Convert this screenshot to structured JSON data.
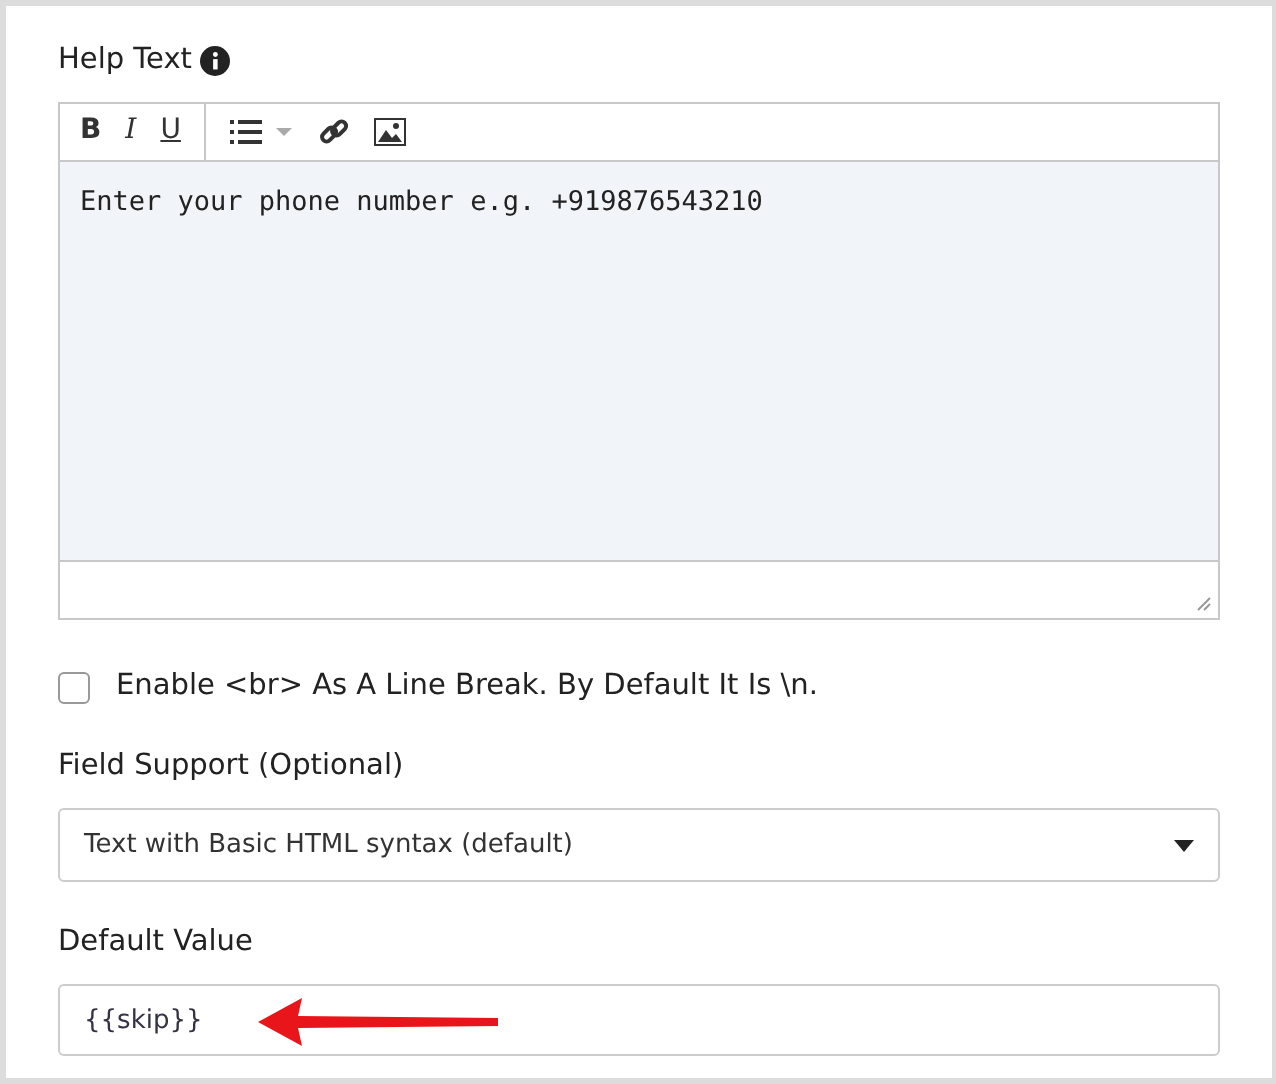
{
  "help_text": {
    "label": "Help Text",
    "toolbar": [
      {
        "kind": "bold",
        "label": "B"
      },
      {
        "kind": "italic",
        "label": "I"
      },
      {
        "kind": "underline",
        "label": "U"
      },
      {
        "kind": "list"
      },
      {
        "kind": "link"
      },
      {
        "kind": "image"
      }
    ],
    "content": "Enter your phone number e.g. +919876543210"
  },
  "line_break_option": {
    "label": "Enable <br> As A Line Break. By Default It Is \\n.",
    "checked": false
  },
  "field_support": {
    "label": "Field Support (Optional)",
    "value": "Text with Basic HTML syntax (default)"
  },
  "default_value": {
    "label": "Default Value",
    "value": "{{skip}}",
    "annotation_arrow": true
  }
}
